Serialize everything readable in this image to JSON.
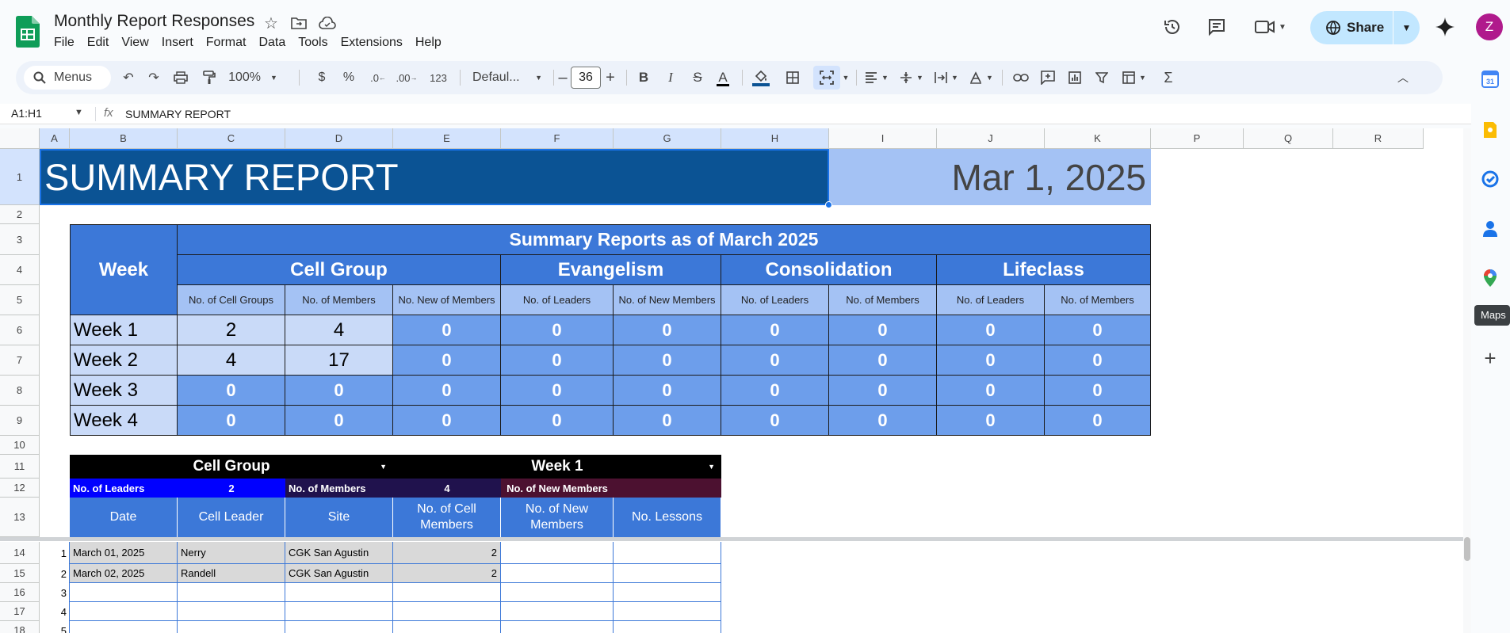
{
  "app": {
    "title": "Monthly Report Responses",
    "menu": [
      "File",
      "Edit",
      "View",
      "Insert",
      "Format",
      "Data",
      "Tools",
      "Extensions",
      "Help"
    ],
    "share_label": "Share",
    "avatar_letter": "Z",
    "colors": {
      "sheets_green": "#0f9d58",
      "share_bg": "#c2e7ff",
      "avatar": "#b01a8c",
      "header_blue": "#0b5394",
      "table_blue": "#3c78d8",
      "light_blue": "#a4c2f4",
      "pale_blue": "#c9daf8"
    }
  },
  "toolbar": {
    "search_label": "Menus",
    "zoom": "100%",
    "currency": "$",
    "percent": "%",
    "dec_decrease": ".0",
    "dec_increase": ".00",
    "number_format": "123",
    "font": "Defaul...",
    "font_size": "36",
    "bold": "B",
    "italic": "I",
    "strike": "S",
    "text_color": "A",
    "icons": [
      "undo-icon",
      "redo-icon",
      "print-icon",
      "paint-format-icon",
      "fill-color-icon",
      "borders-icon",
      "merge-cells-icon",
      "align-icon",
      "valign-icon",
      "wrap-icon",
      "rotate-icon",
      "link-icon",
      "comment-icon",
      "chart-icon",
      "filter-icon",
      "views-icon",
      "functions-icon",
      "collapse-icon"
    ]
  },
  "formula_bar": {
    "name_box": "A1:H1",
    "fx": "fx",
    "value": "SUMMARY REPORT"
  },
  "side_panel": {
    "tooltip": "Maps",
    "icons": [
      "calendar-icon",
      "keep-icon",
      "tasks-icon",
      "contacts-icon",
      "maps-icon",
      "add-icon"
    ],
    "calendar_day": "31"
  },
  "grid": {
    "columns": [
      "A",
      "B",
      "C",
      "D",
      "E",
      "F",
      "G",
      "H",
      "I",
      "J",
      "K",
      "P",
      "Q",
      "R"
    ],
    "rows": [
      "1",
      "2",
      "3",
      "4",
      "5",
      "6",
      "7",
      "8",
      "9",
      "10",
      "11",
      "12",
      "13",
      "14",
      "15",
      "16",
      "17",
      "18"
    ],
    "title": "SUMMARY REPORT",
    "date": "Mar 1, 2025",
    "summary": {
      "heading": "Summary Reports as of March 2025",
      "week_header": "Week",
      "groups": [
        "Cell Group",
        "Evangelism",
        "Consolidation",
        "Lifeclass"
      ],
      "subheaders": [
        "No. of Cell Groups",
        "No. of Members",
        "No. New of Members",
        "No. of Leaders",
        "No. of New Members",
        "No. of Leaders",
        "No. of Members",
        "No. of Leaders",
        "No. of Members"
      ],
      "rows": [
        {
          "week": "Week 1",
          "values": [
            "2",
            "4",
            "0",
            "0",
            "0",
            "0",
            "0",
            "0",
            "0"
          ]
        },
        {
          "week": "Week 2",
          "values": [
            "4",
            "17",
            "0",
            "0",
            "0",
            "0",
            "0",
            "0",
            "0"
          ]
        },
        {
          "week": "Week 3",
          "values": [
            "0",
            "0",
            "0",
            "0",
            "0",
            "0",
            "0",
            "0",
            "0"
          ]
        },
        {
          "week": "Week 4",
          "values": [
            "0",
            "0",
            "0",
            "0",
            "0",
            "0",
            "0",
            "0",
            "0"
          ]
        }
      ]
    },
    "detail": {
      "group_select": "Cell Group",
      "week_select": "Week 1",
      "leaders_label": "No. of Leaders",
      "leaders_value": "2",
      "members_label": "No. of Members",
      "members_value": "4",
      "new_members_label": "No. of New Members",
      "new_members_value": "",
      "headers": [
        "Date",
        "Cell Leader",
        "Site",
        "No. of Cell Members",
        "No. of New Members",
        "No. Lessons"
      ],
      "rows": [
        {
          "n": "1",
          "date": "March 01, 2025",
          "leader": "Nerry",
          "site": "CGK San Agustin",
          "members": "2",
          "new": "",
          "lessons": ""
        },
        {
          "n": "2",
          "date": "March 02, 2025",
          "leader": "Randell",
          "site": "CGK San Agustin",
          "members": "2",
          "new": "",
          "lessons": ""
        },
        {
          "n": "3",
          "date": "",
          "leader": "",
          "site": "",
          "members": "",
          "new": "",
          "lessons": ""
        },
        {
          "n": "4",
          "date": "",
          "leader": "",
          "site": "",
          "members": "",
          "new": "",
          "lessons": ""
        },
        {
          "n": "5",
          "date": "",
          "leader": "",
          "site": "",
          "members": "",
          "new": "",
          "lessons": ""
        }
      ]
    }
  }
}
